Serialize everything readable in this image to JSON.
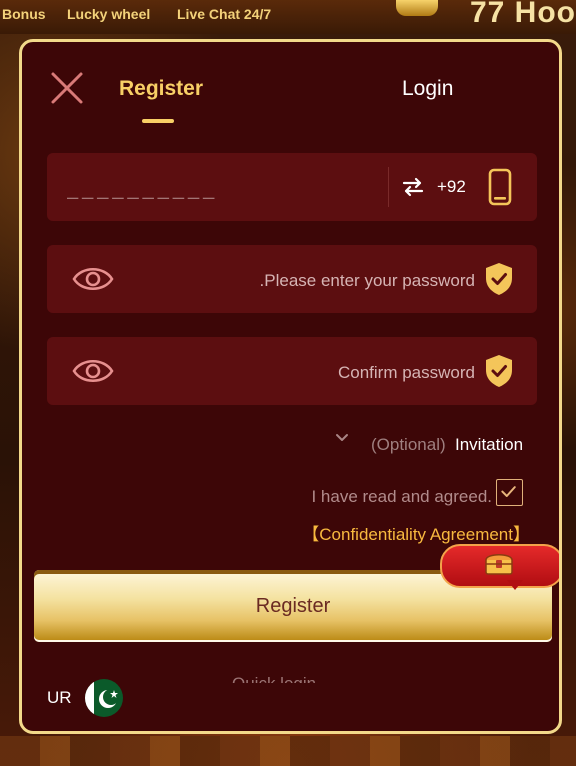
{
  "top_bar": {
    "items": [
      "Bonus",
      "Lucky wheel",
      "Live Chat 24/7"
    ],
    "brand_fragment": "77 Hoo"
  },
  "modal": {
    "tabs": {
      "register": "Register",
      "login": "Login"
    },
    "phone": {
      "placeholder": "__________",
      "country_code": "+92"
    },
    "password": {
      "placeholder": ".Please enter your password"
    },
    "confirm_password": {
      "placeholder": "Confirm password"
    },
    "invitation": {
      "optional": "(Optional)",
      "label": "Invitation"
    },
    "agreement": {
      "text": "I have read and agreed.",
      "checked": true,
      "link": "【Confidentiality Agreement】"
    },
    "register_button": "Register",
    "quick_login": "Quick login",
    "language": "UR"
  },
  "colors": {
    "modal_bg": "#3d0607",
    "border": "#f3d98a",
    "accent": "#f8cf66",
    "field_bg": "#5c0e10",
    "link": "#f8b93f"
  },
  "icons": [
    "close-icon",
    "swap-icon",
    "phone-icon",
    "eye-icon",
    "shield-check-icon",
    "chevron-down-icon",
    "check-icon",
    "treasure-chest-icon",
    "pakistan-flag-icon"
  ]
}
